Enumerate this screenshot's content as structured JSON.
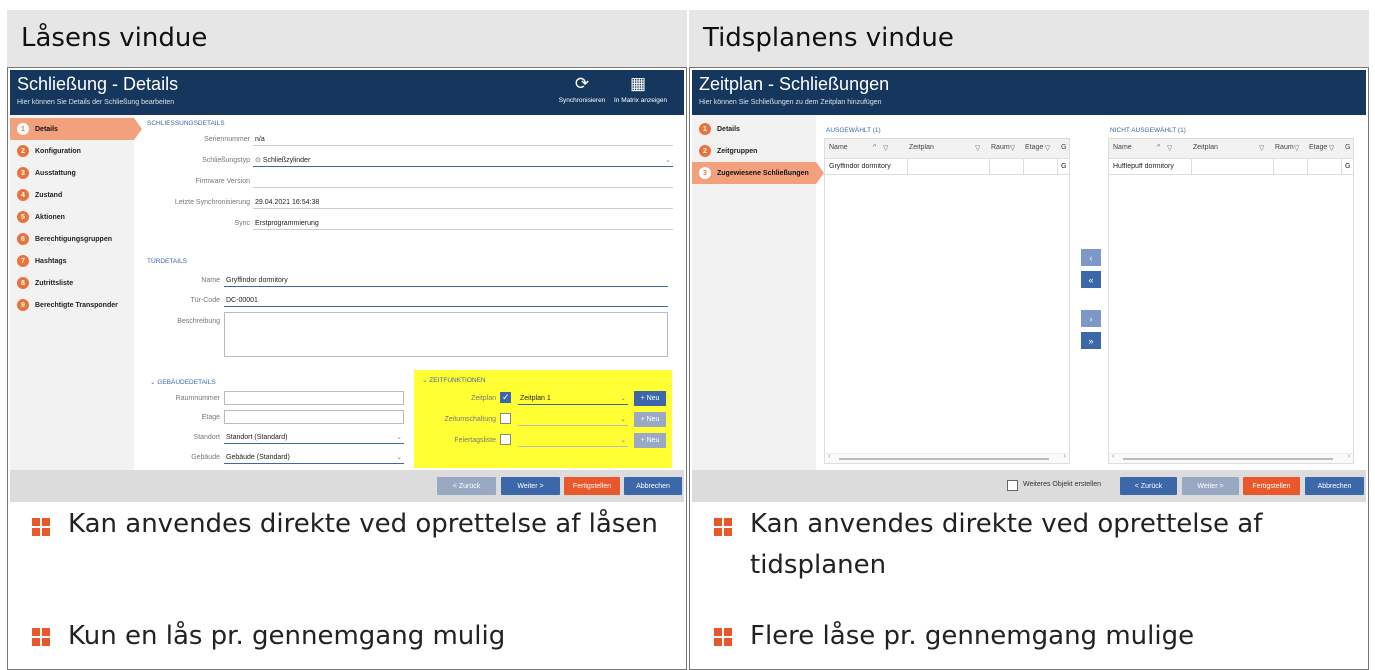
{
  "left": {
    "heading": "Låsens vindue",
    "window": {
      "title": "Schließung - Details",
      "subtitle": "Hier können Sie Details der Schließung bearbeiten",
      "toolbar": [
        {
          "icon": "sync-icon",
          "glyph": "⟳",
          "label": "Synchronisieren"
        },
        {
          "icon": "matrix-grid-icon",
          "glyph": "▦",
          "label": "In Matrix anzeigen"
        }
      ],
      "steps": [
        "Details",
        "Konfiguration",
        "Ausstattung",
        "Zustand",
        "Aktionen",
        "Berechtigungsgruppen",
        "Hashtags",
        "Zutrittsliste",
        "Berechtigte Transponder"
      ],
      "active_step": 0,
      "lock_section": "SCHLIESSUNGSDETAILS",
      "fields": {
        "serial_label": "Seriennummer",
        "serial_value": "n/a",
        "type_label": "Schließungstyp",
        "type_value": "Schließzylinder",
        "firmware_label": "Firmware Version",
        "firmware_value": "",
        "lastsync_label": "Letzte Synchronisierung",
        "lastsync_value": "29.04.2021 16:54:38",
        "sync_label": "Sync",
        "sync_value": "Erstprogrammierung"
      },
      "door_section": "TÜRDETAILS",
      "door": {
        "name_label": "Name",
        "name_value": "Gryffindor dormitory",
        "code_label": "Tür-Code",
        "code_value": "DC-00001",
        "desc_label": "Beschreibung",
        "desc_value": ""
      },
      "building_section": "GEBÄUDEDETAILS",
      "building": {
        "room_label": "Raumnummer",
        "room_value": "",
        "floor_label": "Etage",
        "floor_value": "",
        "site_label": "Standort",
        "site_value": "Standort (Standard)",
        "bldg_label": "Gebäude",
        "bldg_value": "Gebäude (Standard)"
      },
      "time_section": "ZEITFUNKTIONEN",
      "time": {
        "plan_label": "Zeitplan",
        "plan_checked": true,
        "plan_value": "Zeitplan 1",
        "switch_label": "Zeitumschaltung",
        "switch_checked": false,
        "holiday_label": "Feiertagsliste",
        "holiday_checked": false,
        "new_label": "+ Neu"
      },
      "footer": {
        "back": "< Zurück",
        "next": "Weiter >",
        "finish": "Fertigstellen",
        "cancel": "Abbrechen"
      }
    },
    "bullets": [
      "Kan anvendes direkte ved oprettelse af låsen",
      "Kun en lås pr. gennemgang mulig"
    ]
  },
  "right": {
    "heading": "Tidsplanens vindue",
    "window": {
      "title": "Zeitplan - Schließungen",
      "subtitle": "Hier können Sie Schließungen zu dem Zeitplan hinzufügen",
      "steps": [
        "Details",
        "Zeitgruppen",
        "Zugewiesene Schließungen"
      ],
      "active_step": 2,
      "selected": {
        "label": "AUSGEWÄHLT (1)",
        "columns": [
          "Name",
          "Zeitplan",
          "Raum",
          "Etage",
          "G"
        ],
        "rows": [
          [
            "Gryffindor dormitory",
            "",
            "",
            "",
            "G"
          ]
        ]
      },
      "unselected": {
        "label": "NICHT AUSGEWÄHLT (1)",
        "columns": [
          "Name",
          "Zeitplan",
          "Raum",
          "Etage",
          "G"
        ],
        "rows": [
          [
            "Hufflepuff dormitory",
            "",
            "",
            "",
            "G"
          ]
        ]
      },
      "move_buttons": [
        "‹",
        "«",
        "›",
        "»"
      ],
      "footer": {
        "create_more": "Weiteres Objekt erstellen",
        "back": "< Zurück",
        "next": "Weiter >",
        "finish": "Fertigstellen",
        "cancel": "Abbrechen"
      }
    },
    "bullets": [
      "Kan anvendes direkte ved oprettelse af tidsplanen",
      "Flere låse pr. gennemgang mulige"
    ]
  },
  "colors": {
    "navy": "#15375e",
    "orange": "#e8582b",
    "highlight": "#ffff33",
    "blue": "#3c67a8"
  }
}
